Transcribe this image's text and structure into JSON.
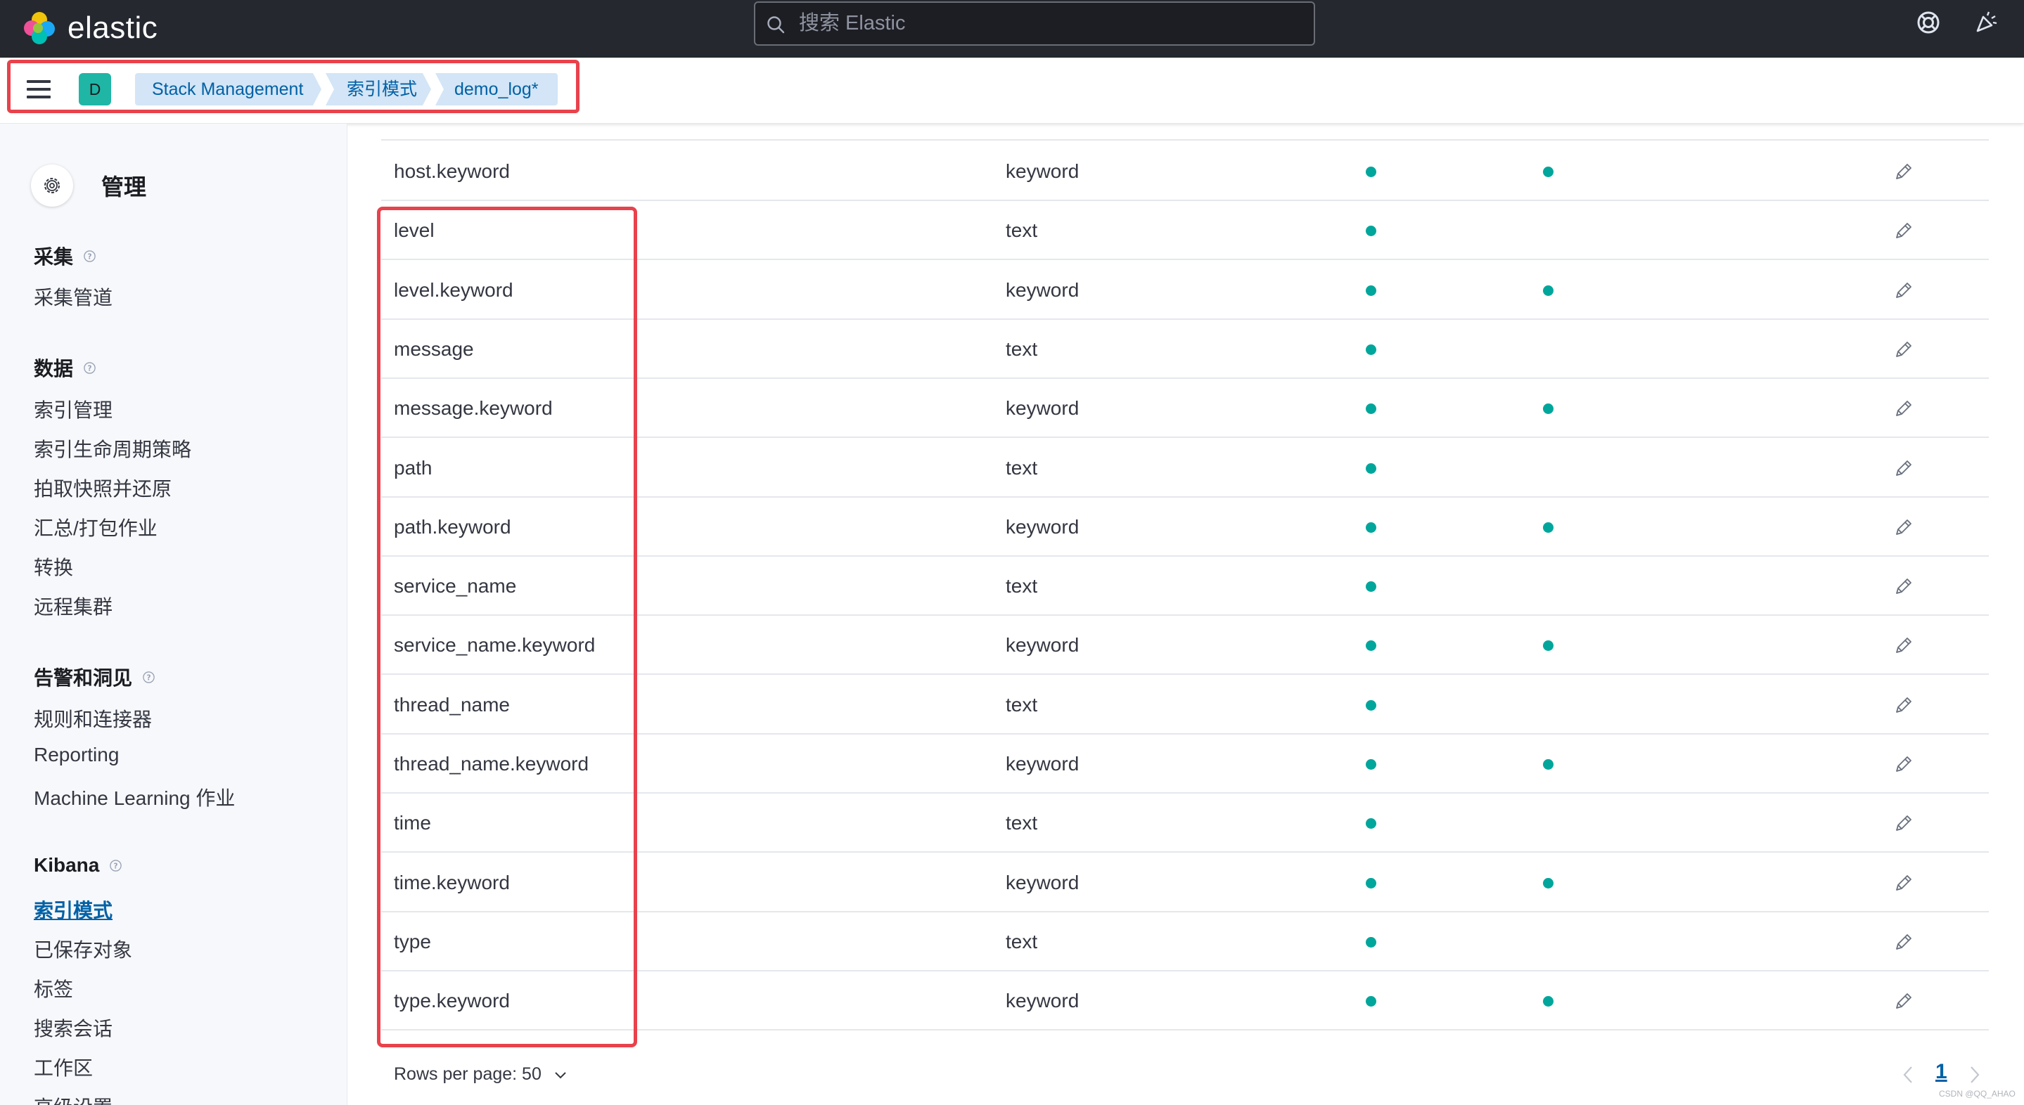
{
  "header": {
    "brand": "elastic",
    "search_placeholder": "搜索 Elastic"
  },
  "breadcrumb": {
    "space_initial": "D",
    "items": [
      "Stack Management",
      "索引模式",
      "demo_log*"
    ]
  },
  "sidebar": {
    "title": "管理",
    "sections": [
      {
        "label": "采集",
        "items": [
          "采集管道"
        ]
      },
      {
        "label": "数据",
        "items": [
          "索引管理",
          "索引生命周期策略",
          "拍取快照并还原",
          "汇总/打包作业",
          "转换",
          "远程集群"
        ]
      },
      {
        "label": "告警和洞见",
        "items": [
          "规则和连接器",
          "Reporting",
          "Machine Learning 作业"
        ]
      },
      {
        "label": "Kibana",
        "items": [
          "索引模式",
          "已保存对象",
          "标签",
          "搜索会话",
          "工作区",
          "高级设置"
        ]
      }
    ],
    "active_item": "索引模式"
  },
  "fields": [
    {
      "name": "host.keyword",
      "type": "keyword",
      "searchable": true,
      "aggregatable": true
    },
    {
      "name": "level",
      "type": "text",
      "searchable": true,
      "aggregatable": false
    },
    {
      "name": "level.keyword",
      "type": "keyword",
      "searchable": true,
      "aggregatable": true
    },
    {
      "name": "message",
      "type": "text",
      "searchable": true,
      "aggregatable": false
    },
    {
      "name": "message.keyword",
      "type": "keyword",
      "searchable": true,
      "aggregatable": true
    },
    {
      "name": "path",
      "type": "text",
      "searchable": true,
      "aggregatable": false
    },
    {
      "name": "path.keyword",
      "type": "keyword",
      "searchable": true,
      "aggregatable": true
    },
    {
      "name": "service_name",
      "type": "text",
      "searchable": true,
      "aggregatable": false
    },
    {
      "name": "service_name.keyword",
      "type": "keyword",
      "searchable": true,
      "aggregatable": true
    },
    {
      "name": "thread_name",
      "type": "text",
      "searchable": true,
      "aggregatable": false
    },
    {
      "name": "thread_name.keyword",
      "type": "keyword",
      "searchable": true,
      "aggregatable": true
    },
    {
      "name": "time",
      "type": "text",
      "searchable": true,
      "aggregatable": false
    },
    {
      "name": "time.keyword",
      "type": "keyword",
      "searchable": true,
      "aggregatable": true
    },
    {
      "name": "type",
      "type": "text",
      "searchable": true,
      "aggregatable": false
    },
    {
      "name": "type.keyword",
      "type": "keyword",
      "searchable": true,
      "aggregatable": true
    }
  ],
  "pagination": {
    "rows_per_page_label": "Rows per page: 50",
    "current_page": "1"
  },
  "watermark": "CSDN @QQ_AHAO",
  "colors": {
    "header_bg": "#25282f",
    "dot": "#00a69b",
    "link": "#0061a6",
    "highlight": "#e8424c",
    "breadcrumb_bg": "#d3e5f6"
  },
  "icons": {
    "logo": "elastic-logo-icon",
    "search": "search-icon",
    "help": "help-lifebuoy-icon",
    "news": "newsfeed-icon",
    "menu": "hamburger-menu-icon",
    "management": "gear-icon",
    "info": "question-circle-icon",
    "edit": "pencil-icon"
  }
}
